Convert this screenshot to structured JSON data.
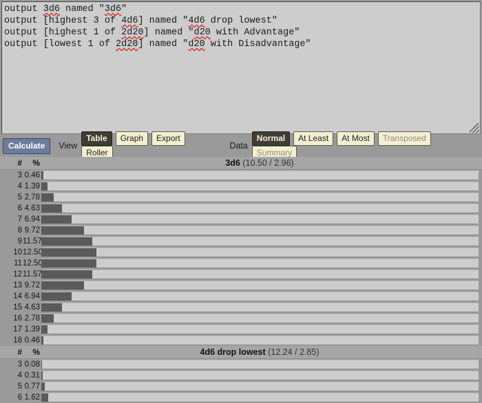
{
  "editor": {
    "lines": [
      [
        {
          "t": "output ",
          "sp": false
        },
        {
          "t": "3d6",
          "sp": true
        },
        {
          "t": " named \"",
          "sp": false
        },
        {
          "t": "3d6",
          "sp": true
        },
        {
          "t": "\"",
          "sp": false
        }
      ],
      [
        {
          "t": "output [highest 3 of ",
          "sp": false
        },
        {
          "t": "4d6",
          "sp": true
        },
        {
          "t": "] named \"",
          "sp": false
        },
        {
          "t": "4d6",
          "sp": true
        },
        {
          "t": " drop lowest\"",
          "sp": false
        }
      ],
      [
        {
          "t": "output [highest 1 of ",
          "sp": false
        },
        {
          "t": "2d20",
          "sp": true
        },
        {
          "t": "] named \"",
          "sp": false
        },
        {
          "t": "d20",
          "sp": true
        },
        {
          "t": " with Advantage\"",
          "sp": false
        }
      ],
      [
        {
          "t": "output [lowest 1 of ",
          "sp": false
        },
        {
          "t": "2d20",
          "sp": true
        },
        {
          "t": "] named \"",
          "sp": false
        },
        {
          "t": "d20",
          "sp": true
        },
        {
          "t": " with Disadvantage\"",
          "sp": false
        }
      ]
    ]
  },
  "toolbar": {
    "calculate_label": "Calculate",
    "view_label": "View",
    "view_options": [
      {
        "label": "Table",
        "selected": true,
        "disabled": false
      },
      {
        "label": "Graph",
        "selected": false,
        "disabled": false
      },
      {
        "label": "Export",
        "selected": false,
        "disabled": false
      },
      {
        "label": "Roller",
        "selected": false,
        "disabled": false
      }
    ],
    "data_label": "Data",
    "data_options": [
      {
        "label": "Normal",
        "selected": true,
        "disabled": false
      },
      {
        "label": "At Least",
        "selected": false,
        "disabled": false
      },
      {
        "label": "At Most",
        "selected": false,
        "disabled": false
      },
      {
        "label": "Transposed",
        "selected": false,
        "disabled": true
      },
      {
        "label": "Summary",
        "selected": false,
        "disabled": true
      }
    ]
  },
  "table": {
    "col_num_header": "#",
    "col_pct_header": "%"
  },
  "chart_data": [
    {
      "type": "bar",
      "title": "3d6",
      "mean": "10.50",
      "stddev": "2.96",
      "stats_text": "(10.50 / 2.96)",
      "xlabel": "#",
      "ylabel": "%",
      "max_pct": 12.5,
      "categories": [
        3,
        4,
        5,
        6,
        7,
        8,
        9,
        10,
        11,
        12,
        13,
        14,
        15,
        16,
        17,
        18
      ],
      "values": [
        0.46,
        1.39,
        2.78,
        4.63,
        6.94,
        9.72,
        11.57,
        12.5,
        12.5,
        11.57,
        9.72,
        6.94,
        4.63,
        2.78,
        1.39,
        0.46
      ],
      "labels": [
        "0.46",
        "1.39",
        "2.78",
        "4.63",
        "6.94",
        "9.72",
        "11.57",
        "12.50",
        "12.50",
        "11.57",
        "9.72",
        "6.94",
        "4.63",
        "2.78",
        "1.39",
        "0.46"
      ]
    },
    {
      "type": "bar",
      "title": "4d6 drop lowest",
      "mean": "12.24",
      "stddev": "2.85",
      "stats_text": "(12.24 / 2.85)",
      "xlabel": "#",
      "ylabel": "%",
      "max_pct": 12.5,
      "categories": [
        3,
        4,
        5,
        6
      ],
      "values": [
        0.08,
        0.31,
        0.77,
        1.62
      ],
      "labels": [
        "0.08",
        "0.31",
        "0.77",
        "1.62"
      ]
    }
  ]
}
